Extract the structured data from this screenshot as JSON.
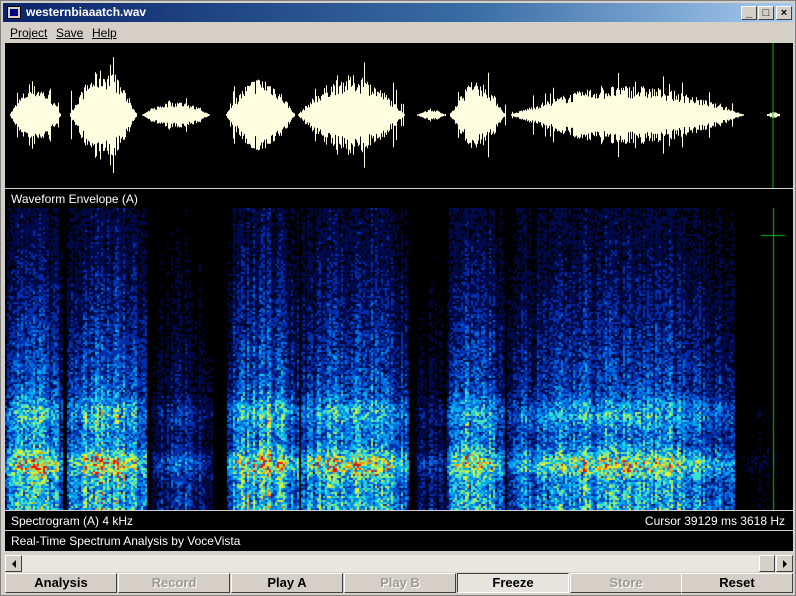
{
  "window": {
    "title": "westernbiaaatch.wav",
    "controls": {
      "minimize": "_",
      "maximize": "□",
      "close": "×"
    }
  },
  "menu": {
    "items": [
      {
        "label": "Project",
        "name": "menu-project"
      },
      {
        "label": "Save",
        "name": "menu-save"
      },
      {
        "label": "Help",
        "name": "menu-help"
      }
    ]
  },
  "waveform": {
    "label": "Waveform Envelope (A)",
    "color": "#fffde0",
    "cursor_color": "#00c000"
  },
  "spectrogram": {
    "label": "Spectrogram (A)   4 kHz",
    "cursor_readout": "Cursor  39129 ms  3618 Hz",
    "palette": [
      "#000000",
      "#000a4a",
      "#0030b0",
      "#0070e0",
      "#00b0f0",
      "#40e0d0",
      "#a0f060",
      "#f0f020",
      "#ff9000",
      "#e01010"
    ]
  },
  "status": {
    "text": "Real-Time Spectrum Analysis by VoceVista"
  },
  "buttons": [
    {
      "label": "Analysis",
      "name": "analysis-button",
      "enabled": true,
      "pressed": false
    },
    {
      "label": "Record",
      "name": "record-button",
      "enabled": false,
      "pressed": false
    },
    {
      "label": "Play A",
      "name": "play-a-button",
      "enabled": true,
      "pressed": false
    },
    {
      "label": "Play B",
      "name": "play-b-button",
      "enabled": false,
      "pressed": false
    },
    {
      "label": "Freeze",
      "name": "freeze-button",
      "enabled": true,
      "pressed": true
    },
    {
      "label": "Store",
      "name": "store-button",
      "enabled": false,
      "pressed": false
    },
    {
      "label": "Reset",
      "name": "reset-button",
      "enabled": true,
      "pressed": false
    }
  ]
}
